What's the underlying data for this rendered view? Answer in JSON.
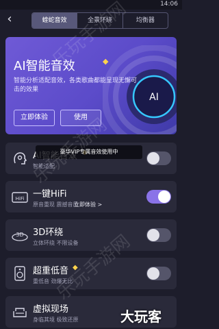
{
  "status_bar": {
    "time": "14:06"
  },
  "nav": {
    "back_icon": "back-arrow-icon",
    "tabs": [
      {
        "label": "蝰蛇音效",
        "active": true
      },
      {
        "label": "全景环绕",
        "active": false
      },
      {
        "label": "均衡器",
        "active": false
      }
    ]
  },
  "hero": {
    "title": "AI智能音效",
    "badge_icon": "vip-diamond-icon",
    "description": "智能分析适配音效，各类歌曲都能呈现无懈可击的效果",
    "ring_label": "AI",
    "try_label": "立即体验",
    "use_label": "使用",
    "colors": {
      "bg_start": "#6f5ad6",
      "bg_end": "#3f3aa8",
      "ring_glow": "#36c8ff"
    }
  },
  "toast": "豪华VIP专属音效使用中",
  "effects": [
    {
      "title": "AI智能音效",
      "subtitle": "智能适配",
      "icon": "ai-head-icon",
      "vip": true,
      "enabled": false
    },
    {
      "title": "一键HiFi",
      "subtitle": "原音重现 震撼音质",
      "link": "立即体验 >",
      "icon": "hifi-icon",
      "vip": false,
      "enabled": true
    },
    {
      "title": "3D环绕",
      "subtitle": "立体环绕 不限设备",
      "icon": "3d-icon",
      "vip": false,
      "enabled": false
    },
    {
      "title": "超重低音",
      "subtitle": "重低音 劲爆无比",
      "icon": "speaker-icon",
      "vip": true,
      "enabled": false
    },
    {
      "title": "虚拟现场",
      "subtitle": "身临其境 极致还原",
      "icon": "sofa-icon",
      "vip": false,
      "enabled": false
    }
  ],
  "watermark": "乐玩手游网",
  "corner_mark": "大玩客",
  "colors": {
    "accent": "#8a73e8",
    "vip": "#ffd34d",
    "card_bg": "#2a2a3a",
    "page_bg": "#1d1d2b"
  }
}
